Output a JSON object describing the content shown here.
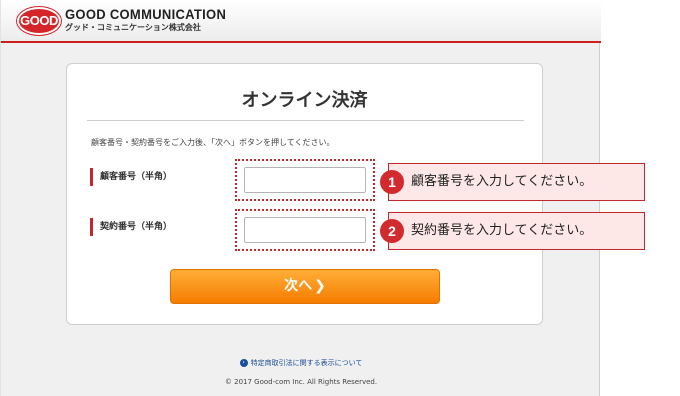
{
  "header": {
    "logo_badge": "GOOD",
    "logo_main": "GOOD COMMUNICATION",
    "logo_sub": "グッド・コミュニケーション株式会社"
  },
  "card": {
    "title": "オンライン決済",
    "instructions": "顧客番号・契約番号をご入力後、「次へ」ボタンを押してください。",
    "fields": [
      {
        "label": "顧客番号（半角）",
        "value": "",
        "placeholder": ""
      },
      {
        "label": "契約番号（半角）",
        "value": "",
        "placeholder": ""
      }
    ],
    "next_button": {
      "label": "次へ",
      "chevron": "❯"
    }
  },
  "footer": {
    "link_icon": "›",
    "link_text": "特定商取引法に関する表示について",
    "copyright": "© 2017 Good-com Inc. All Rights Reserved."
  },
  "callouts": [
    {
      "number": "1",
      "text": "顧客番号を入力してください。"
    },
    {
      "number": "2",
      "text": "契約番号を入力してください。"
    }
  ],
  "colors": {
    "brand_red": "#c0282d",
    "button_orange": "#f57c00",
    "callout_bg": "#fde7e7",
    "link_blue": "#1a4e9a"
  }
}
